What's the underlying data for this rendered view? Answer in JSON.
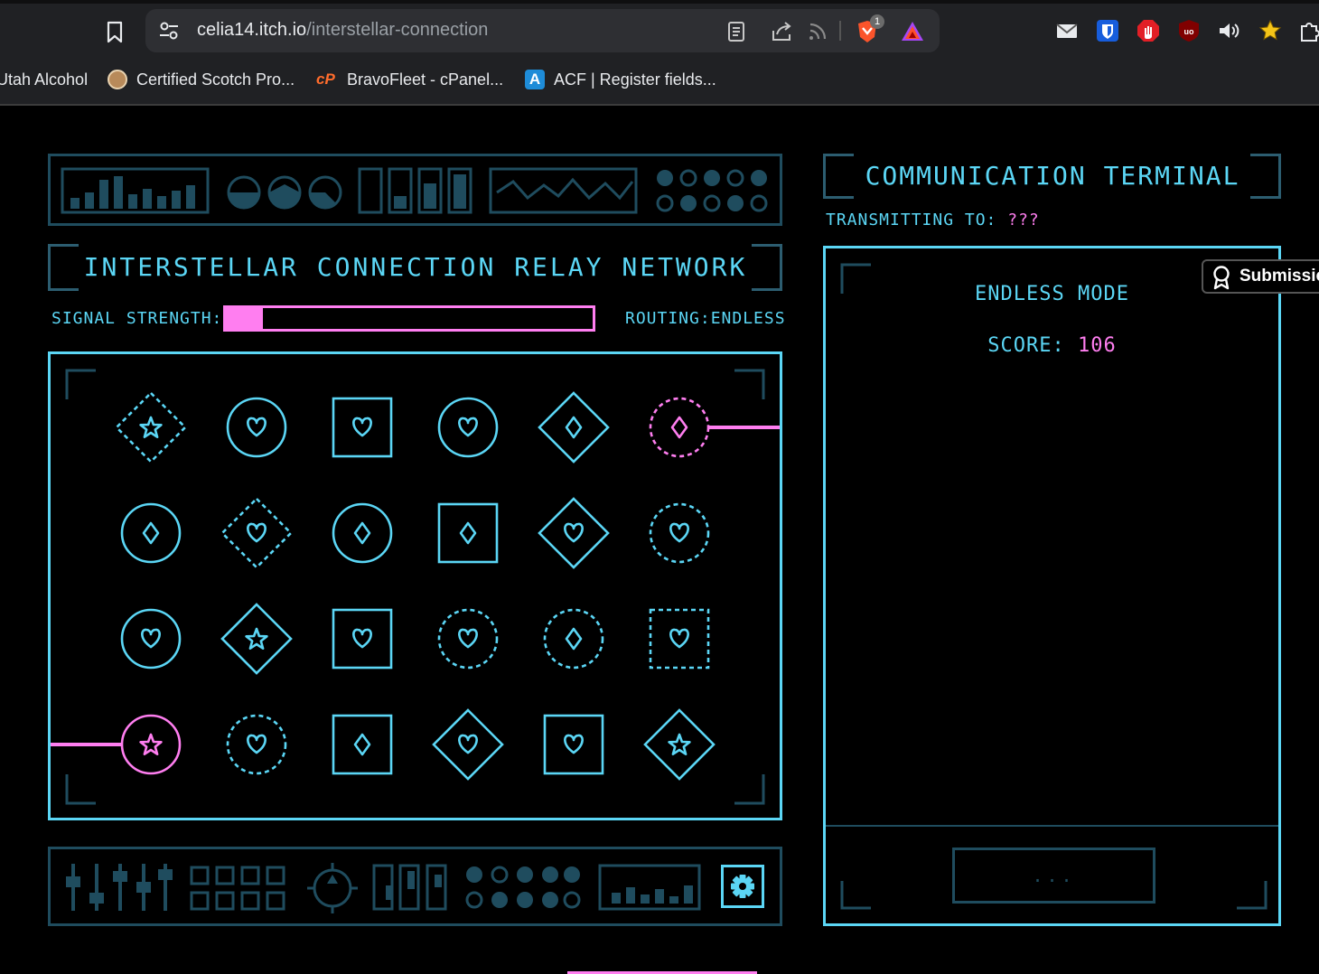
{
  "browser": {
    "url_host": "celia14.itch.io",
    "url_path": "/interstellar-connection",
    "brave_badge": "1",
    "bookmarks": [
      {
        "label": "Utah Alcohol"
      },
      {
        "label": "Certified Scotch Pro..."
      },
      {
        "label": "BravoFleet - cPanel..."
      },
      {
        "label": "ACF | Register fields..."
      }
    ]
  },
  "game": {
    "title": "INTERSTELLAR CONNECTION RELAY NETWORK",
    "signal_label": "SIGNAL STRENGTH:",
    "signal_strength_fraction": 0.1,
    "routing_label": "ROUTING:ENDLESS",
    "grid": {
      "rows": [
        [
          {
            "shape": "diamond",
            "style": "dashed",
            "symbol": "star",
            "active": false
          },
          {
            "shape": "circle",
            "style": "solid",
            "symbol": "heart",
            "active": false
          },
          {
            "shape": "square",
            "style": "solid",
            "symbol": "heart",
            "active": false
          },
          {
            "shape": "circle",
            "style": "solid",
            "symbol": "heart",
            "active": false
          },
          {
            "shape": "diamond",
            "style": "solid",
            "symbol": "diamond",
            "active": false
          },
          {
            "shape": "circle",
            "style": "dashed",
            "symbol": "diamond",
            "active": true
          }
        ],
        [
          {
            "shape": "circle",
            "style": "solid",
            "symbol": "diamond",
            "active": false
          },
          {
            "shape": "diamond",
            "style": "dashed",
            "symbol": "heart",
            "active": false
          },
          {
            "shape": "circle",
            "style": "solid",
            "symbol": "diamond",
            "active": false
          },
          {
            "shape": "square",
            "style": "solid",
            "symbol": "diamond",
            "active": false
          },
          {
            "shape": "diamond",
            "style": "solid",
            "symbol": "heart",
            "active": false
          },
          {
            "shape": "circle",
            "style": "dashed",
            "symbol": "heart",
            "active": false
          }
        ],
        [
          {
            "shape": "circle",
            "style": "solid",
            "symbol": "heart",
            "active": false
          },
          {
            "shape": "diamond",
            "style": "solid",
            "symbol": "star",
            "active": false
          },
          {
            "shape": "square",
            "style": "solid",
            "symbol": "heart",
            "active": false
          },
          {
            "shape": "circle",
            "style": "dashed",
            "symbol": "heart",
            "active": false
          },
          {
            "shape": "circle",
            "style": "dashed",
            "symbol": "diamond",
            "active": false
          },
          {
            "shape": "square",
            "style": "dashed",
            "symbol": "heart",
            "active": false
          }
        ],
        [
          {
            "shape": "circle",
            "style": "solid",
            "symbol": "star",
            "active": true
          },
          {
            "shape": "circle",
            "style": "dashed",
            "symbol": "heart",
            "active": false
          },
          {
            "shape": "square",
            "style": "solid",
            "symbol": "diamond",
            "active": false
          },
          {
            "shape": "diamond",
            "style": "solid",
            "symbol": "heart",
            "active": false
          },
          {
            "shape": "square",
            "style": "solid",
            "symbol": "heart",
            "active": false
          },
          {
            "shape": "diamond",
            "style": "solid",
            "symbol": "star",
            "active": false
          }
        ]
      ],
      "entry_row": 3,
      "exit_row": 0
    },
    "settings_icon": "gear-icon"
  },
  "terminal": {
    "title": "COMMUNICATION TERMINAL",
    "transmit_label": "TRANSMITTING TO:",
    "transmit_target": "???",
    "mode": "ENDLESS MODE",
    "score_label": "SCORE:",
    "score_value": "106",
    "send_button": "..."
  },
  "itch": {
    "submission_label": "Submission"
  },
  "colors": {
    "cyan": "#5bd6f5",
    "pink": "#ff7ef0",
    "dim": "#1f4c5e"
  }
}
